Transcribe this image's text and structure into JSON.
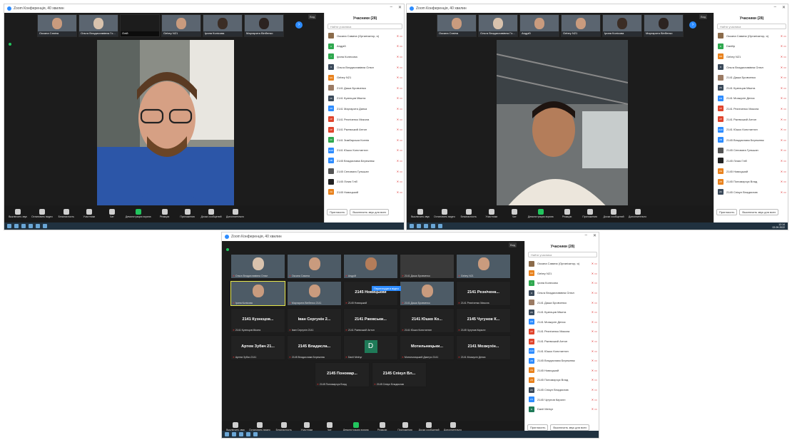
{
  "window": {
    "title": "Zoom Конференція, 40 хвилин"
  },
  "shot1": {
    "view_label": "Вид",
    "thumbs": [
      "Оксана Сєвіна",
      "Ольга Владиславівна Го...",
      "Олій",
      "Gebey N21",
      "Ірина Колісова",
      "Маргарита Вінбенко"
    ],
    "speaker_name": "Андрій",
    "panel_title": "Учасники (28)",
    "search_placeholder": "Найти учасника",
    "participants": [
      {
        "name": "Оксана Савина (Організатор, я)",
        "color": "#8b6b4a",
        "init": ""
      },
      {
        "name": "Андрій",
        "color": "#2fa84f",
        "init": "A"
      },
      {
        "name": "Ірина Колесова",
        "color": "#2fa84f",
        "init": "I"
      },
      {
        "name": "Ольга Владиславівна Олюл",
        "color": "#3b4a5a",
        "init": "O"
      },
      {
        "name": "Gebey N21",
        "color": "#e8821e",
        "init": "GN"
      },
      {
        "name": "2141 Даша Бровченко",
        "color": "#9b7b64",
        "init": ""
      },
      {
        "name": "2141 Кузнєцов Мікита",
        "color": "#3b4a5a",
        "init": "2K"
      },
      {
        "name": "2141 Маргарита Данка",
        "color": "#2d8cff",
        "init": "2M"
      },
      {
        "name": "2141 Резніченко Микола",
        "color": "#e0452d",
        "init": "2P"
      },
      {
        "name": "2141 Ржевський Антон",
        "color": "#e0452d",
        "init": "2P"
      },
      {
        "name": "2141 Зимбарська Ксенія",
        "color": "#2fa84f",
        "init": "2C"
      },
      {
        "name": "2141 Юшко Константин",
        "color": "#2d8cff",
        "init": "2HO"
      },
      {
        "name": "2145 Владислава Бережнюк",
        "color": "#2d8cff",
        "init": "2B"
      },
      {
        "name": "2145 Сеновата Гульшан",
        "color": "#555",
        "init": ""
      },
      {
        "name": "2145 Лілия Гліб",
        "color": "#222",
        "init": ""
      },
      {
        "name": "2145 Новицький",
        "color": "#e8821e",
        "init": "2H"
      }
    ],
    "invite_label": "Пригласить",
    "mute_all_label": "Выключить звук для всех"
  },
  "shot2": {
    "view_label": "Вид",
    "thumbs": [
      "Оксана Сєвіна",
      "Ольга Владиславівна Го...",
      "Андрій",
      "Gebey N21",
      "Ірина Колісова",
      "Маргарита Вінбенко"
    ],
    "speaker_name": "Danilip",
    "panel_title": "Учасники (28)",
    "search_placeholder": "Найти учасника",
    "participants": [
      {
        "name": "Оксана Савина (Організатор, я)",
        "color": "#8b6b4a",
        "init": ""
      },
      {
        "name": "Danilip",
        "color": "#2fa84f",
        "init": "D"
      },
      {
        "name": "Gebey N21",
        "color": "#e8821e",
        "init": "GN"
      },
      {
        "name": "Ольга Владиславівна Олюл",
        "color": "#3b4a5a",
        "init": "O"
      },
      {
        "name": "2141 Даша Бровченко",
        "color": "#9b7b64",
        "init": ""
      },
      {
        "name": "2141 Кузнєцов Мікита",
        "color": "#3b4a5a",
        "init": "2K"
      },
      {
        "name": "2141 Мозжухін Денис",
        "color": "#2d8cff",
        "init": "2M"
      },
      {
        "name": "2141 Резніченко Микола",
        "color": "#e0452d",
        "init": "2P"
      },
      {
        "name": "2141 Ржевський Антон",
        "color": "#e0452d",
        "init": "2P"
      },
      {
        "name": "2141 Юшко Константин",
        "color": "#2d8cff",
        "init": "2HO"
      },
      {
        "name": "2145 Владислава Бережнюк",
        "color": "#2d8cff",
        "init": "2B"
      },
      {
        "name": "2145 Сеновата Гульшан",
        "color": "#555",
        "init": ""
      },
      {
        "name": "2145 Лілия Гліб",
        "color": "#222",
        "init": ""
      },
      {
        "name": "2145 Новицький",
        "color": "#e8821e",
        "init": "2H"
      },
      {
        "name": "2145 Пономарчук Влад",
        "color": "#e8821e",
        "init": "2П"
      },
      {
        "name": "2145 Спікул Владислав",
        "color": "#3b4a5a",
        "init": "2C"
      }
    ],
    "invite_label": "Пригласить",
    "mute_all_label": "Выключить звук для всех",
    "time": "12:14",
    "date": "02.09.2022"
  },
  "shot3": {
    "view_label": "Вид",
    "panel_title": "Учасники (28)",
    "search_placeholder": "Найти учасника",
    "tooltip": "Переглядати відео",
    "tiles_row1": [
      "Ольга Владиславівна Олюл",
      "Оксана Савина",
      "Андрій",
      "2141 Даша Бровченко",
      "Gebey N21"
    ],
    "tiles_row2": [
      {
        "name": "",
        "cap": "Ірина Колісова",
        "video": true
      },
      {
        "name": "",
        "cap": "Маргарита Вінбенко 2141",
        "video": true
      },
      {
        "name": "2145 Новицький",
        "cap": "2145 Новицький",
        "video": false
      },
      {
        "name": "",
        "cap": "2141 Даша Бровченко",
        "video": true
      },
      {
        "name": "2141 Резніченк...",
        "cap": "2141 Резніченко Микола",
        "video": false
      }
    ],
    "tiles_row3": [
      {
        "name": "2141 Кузнєцов...",
        "cap": "2141 Кузнєцов Мікита"
      },
      {
        "name": "Іван Сергунін 2...",
        "cap": "Іван Сергунін 2141"
      },
      {
        "name": "2141 Ржевськи...",
        "cap": "2141 Ржевський Антон"
      },
      {
        "name": "2141 Юшко Ко...",
        "cap": "2141 Юшко Константин"
      },
      {
        "name": "2145 Чугунов К...",
        "cap": "2145 Чугунов Кирилл"
      }
    ],
    "tiles_row4": [
      {
        "name": "Артем Зубач 21...",
        "cap": "Артем Зубач 2141"
      },
      {
        "name": "2145 Владисла...",
        "cap": "2145 Владислава Бережнюк"
      },
      {
        "name": "D",
        "cap": "Danil Melnyr"
      },
      {
        "name": "Мотильницьки...",
        "cap": "Мотильницький Дмитро 2141"
      },
      {
        "name": "2141 Мозжухін...",
        "cap": "2141 Мозжухін Денис"
      }
    ],
    "tiles_row5": [
      {
        "name": "2145 Пономар...",
        "cap": "2145 Пономарчук Влад"
      },
      {
        "name": "2145 Спікул Вл...",
        "cap": "2145 Спікул Владислав"
      }
    ],
    "participants": [
      {
        "name": "Оксана Савина (Організатор, я)",
        "color": "#8b6b4a",
        "init": ""
      },
      {
        "name": "Gebey N21",
        "color": "#e8821e",
        "init": "GN"
      },
      {
        "name": "Ірина Колесова",
        "color": "#2fa84f",
        "init": "I"
      },
      {
        "name": "Ольга Владиславівна Олюл",
        "color": "#3b4a5a",
        "init": "O"
      },
      {
        "name": "2141 Даша Бровченко",
        "color": "#9b7b64",
        "init": ""
      },
      {
        "name": "2141 Кузнєцов Мікита",
        "color": "#3b4a5a",
        "init": "2K"
      },
      {
        "name": "2141 Мозжухін Денис",
        "color": "#2d8cff",
        "init": "2M"
      },
      {
        "name": "2141 Резніченко Микола",
        "color": "#e0452d",
        "init": "2P"
      },
      {
        "name": "2141 Ржевський Антон",
        "color": "#e0452d",
        "init": "2P"
      },
      {
        "name": "2141 Юшко Константин",
        "color": "#2d8cff",
        "init": "2HO"
      },
      {
        "name": "2145 Владислава Бережнюк",
        "color": "#2d8cff",
        "init": "2B"
      },
      {
        "name": "2145 Новицький",
        "color": "#e8821e",
        "init": "2H"
      },
      {
        "name": "2145 Пономарчук Влад",
        "color": "#e8821e",
        "init": "2П"
      },
      {
        "name": "2145 Спікул Владислав",
        "color": "#3b4a5a",
        "init": "2C"
      },
      {
        "name": "2145 Чугунов Кирилл",
        "color": "#2d8cff",
        "init": "2Ч"
      },
      {
        "name": "Danil Melnyr",
        "color": "#1f7a58",
        "init": "D"
      }
    ],
    "invite_label": "Пригласить",
    "mute_all_label": "Выключить звук для всех"
  },
  "toolbar": {
    "mute": "Выключить звук",
    "video": "Остановить видео",
    "security": "Безопасность",
    "participants": "Участники",
    "chat": "Чат",
    "share": "Демонстрация экрана",
    "reactions": "Реакции",
    "apps": "Приложения",
    "whiteboard": "Доска сообщений",
    "more": "Дополнительно",
    "end": "Завершение"
  },
  "icons": {
    "close": "close-icon",
    "minimize": "minimize-icon",
    "shield": "shield-icon",
    "microphone": "microphone-icon",
    "camera": "camera-icon",
    "people": "people-icon",
    "chat": "chat-icon",
    "share": "share-screen-icon"
  }
}
